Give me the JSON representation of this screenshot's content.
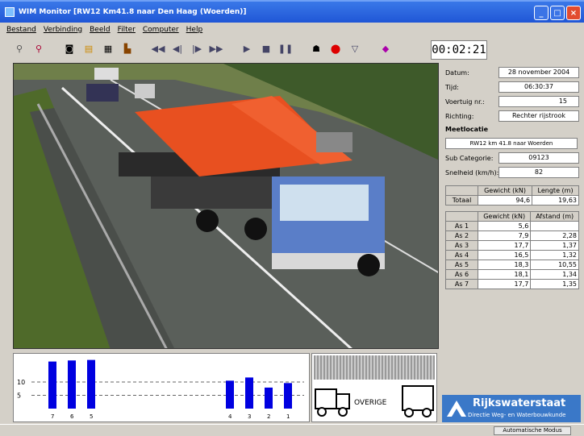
{
  "window": {
    "title": "WIM Monitor [RW12 Km41.8 naar Den Haag (Woerden)]"
  },
  "menu": [
    "Bestand",
    "Verbinding",
    "Beeld",
    "Filter",
    "Computer",
    "Help"
  ],
  "timer": "00:02:21",
  "fields": {
    "datum_label": "Datum:",
    "datum": "28 november 2004",
    "tijd_label": "Tijd:",
    "tijd": "06:30:37",
    "voertuig_label": "Voertuig nr.:",
    "voertuig": "15",
    "richting_label": "Richting:",
    "richting": "Rechter rijstrook",
    "meetlocatie_label": "Meetlocatie",
    "meetlocatie": "RW12 km 41.8 naar Woerden",
    "subcat_label": "Sub Categorie:",
    "subcat": "09123",
    "snelheid_label": "Snelheid (km/h):",
    "snelheid": "82"
  },
  "totals": {
    "headers": [
      "",
      "Gewicht (kN)",
      "Lengte (m)"
    ],
    "label": "Totaal",
    "gewicht": "94,6",
    "lengte": "19,63"
  },
  "axles": {
    "headers": [
      "",
      "Gewicht (kN)",
      "Afstand (m)"
    ],
    "rows": [
      {
        "label": "As 1",
        "gewicht": "5,6",
        "afstand": ""
      },
      {
        "label": "As 2",
        "gewicht": "7,9",
        "afstand": "2,28"
      },
      {
        "label": "As 3",
        "gewicht": "17,7",
        "afstand": "1,37"
      },
      {
        "label": "As 4",
        "gewicht": "16,5",
        "afstand": "1,32"
      },
      {
        "label": "As 5",
        "gewicht": "18,3",
        "afstand": "10,55"
      },
      {
        "label": "As 6",
        "gewicht": "18,1",
        "afstand": "1,34"
      },
      {
        "label": "As 7",
        "gewicht": "17,7",
        "afstand": "1,35"
      }
    ]
  },
  "chart_data": {
    "type": "bar",
    "categories": [
      "7",
      "6",
      "5",
      "4",
      "3",
      "2",
      "1"
    ],
    "values": [
      17.7,
      18.1,
      18.3,
      10.5,
      11.7,
      7.9,
      9.6
    ],
    "ylim": [
      0,
      20
    ],
    "yticks": [
      "10",
      "5"
    ]
  },
  "overige_label": "OVERIGE",
  "brand": {
    "name": "Rijkswaterstaat",
    "sub": "Directie Weg- en Waterbouwkunde"
  },
  "status": {
    "button": "Automatische Modus"
  }
}
